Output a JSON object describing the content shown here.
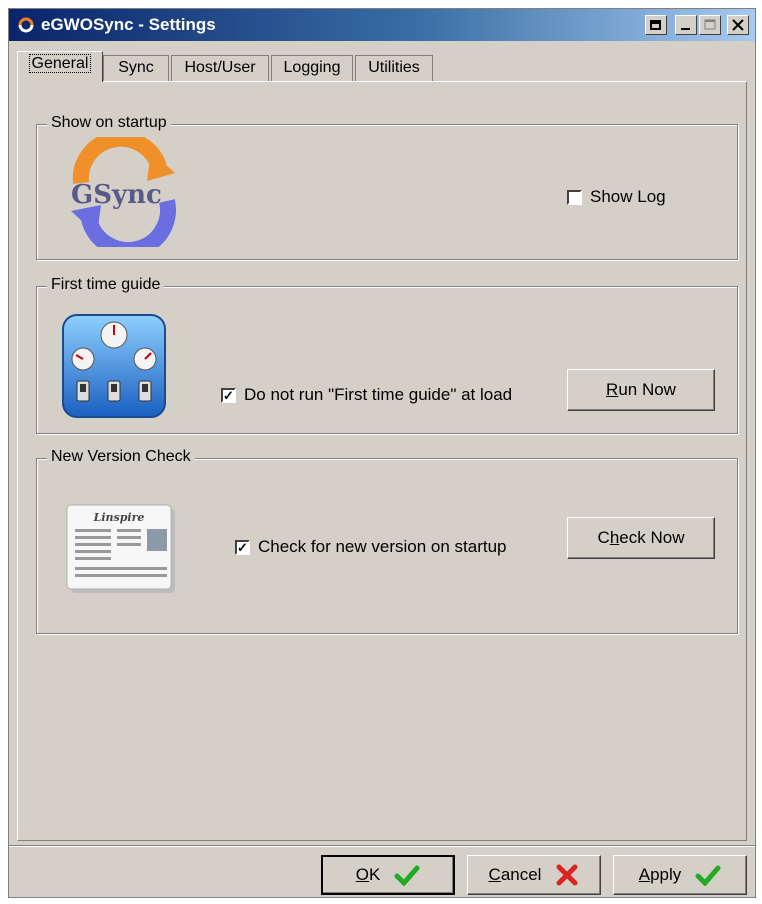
{
  "window": {
    "title": "eGWOSync - Settings"
  },
  "tabs": [
    {
      "label": "General",
      "active": true
    },
    {
      "label": "Sync"
    },
    {
      "label": "Host/User"
    },
    {
      "label": "Logging"
    },
    {
      "label": "Utilities"
    }
  ],
  "groups": {
    "startup": {
      "label": "Show on startup",
      "logo_text": "GSync",
      "checkbox_label": "Show Log",
      "checked": false
    },
    "guide": {
      "label": "First time guide",
      "checkbox_label": "Do not run \"First time guide\" at load",
      "checked": true,
      "button_label": "Run Now"
    },
    "version": {
      "label": "New Version Check",
      "checkbox_label": "Check for new version on startup",
      "checked": true,
      "button_label": "Check Now",
      "newspaper_title": "Linspire"
    }
  },
  "footer": {
    "ok_label": "OK",
    "cancel_label": "Cancel",
    "apply_label": "Apply"
  },
  "colors": {
    "title_start": "#0a246a",
    "title_end": "#a6caf0",
    "ok_green": "#22aa22",
    "cancel_red": "#dd2222"
  },
  "icons": {
    "startup": "sync-logo-icon",
    "guide": "gauges-switches-icon",
    "version": "newspaper-icon",
    "ok": "green-checkmark-icon",
    "cancel": "red-x-icon",
    "apply": "green-checkmark-icon"
  }
}
